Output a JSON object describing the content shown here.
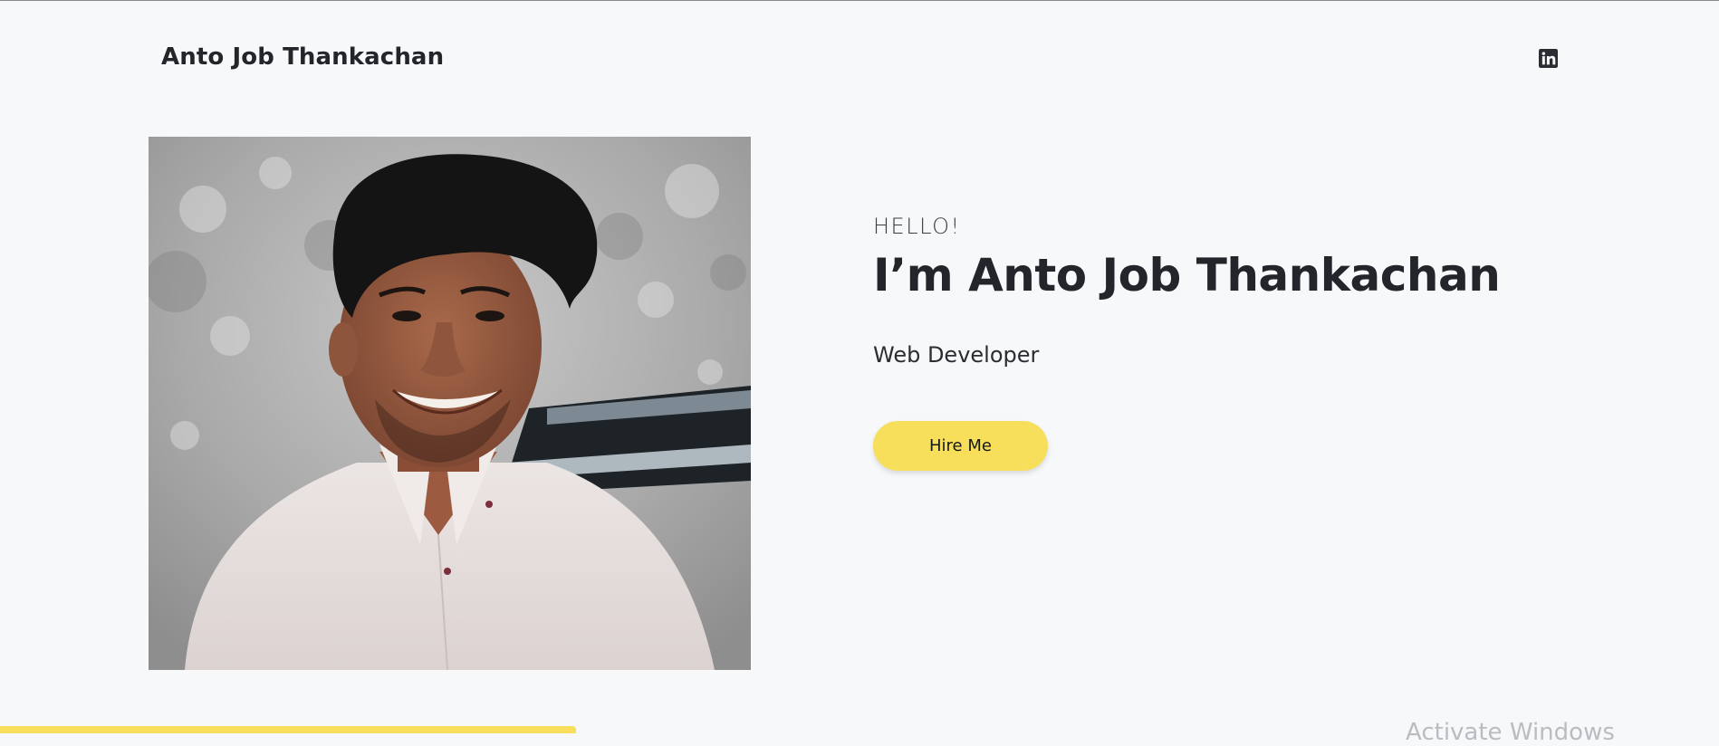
{
  "header": {
    "brand": "Anto Job Thankachan",
    "social_icon": "linkedin-icon"
  },
  "hero": {
    "greeting": "HELLO!",
    "headline": "I’m Anto Job Thankachan",
    "role": "Web Developer",
    "cta_label": "Hire Me",
    "photo_subject": "portrait-photo"
  },
  "scroll_progress": {
    "fraction": 0.335
  },
  "overlay": {
    "watermark": "Activate Windows"
  },
  "colors": {
    "background": "#f7f8fa",
    "accent_yellow": "#f7df5c",
    "text_dark": "#23252a"
  }
}
